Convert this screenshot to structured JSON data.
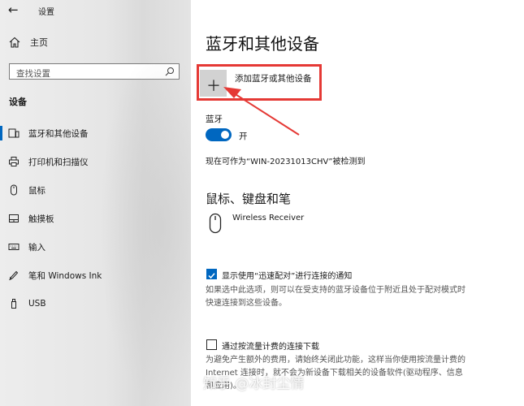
{
  "window": {
    "title": "设置",
    "back_icon": "back-arrow-icon"
  },
  "sidebar": {
    "home_label": "主页",
    "search_placeholder": "查找设置",
    "section_label": "设备",
    "selected_index": 0,
    "items": [
      {
        "label": "蓝牙和其他设备",
        "icon": "bluetooth-devices-icon"
      },
      {
        "label": "打印机和扫描仪",
        "icon": "printer-icon"
      },
      {
        "label": "鼠标",
        "icon": "mouse-icon"
      },
      {
        "label": "触摸板",
        "icon": "touchpad-icon"
      },
      {
        "label": "输入",
        "icon": "keyboard-icon"
      },
      {
        "label": "笔和 Windows Ink",
        "icon": "pen-icon"
      },
      {
        "label": "USB",
        "icon": "usb-icon"
      }
    ]
  },
  "main": {
    "title": "蓝牙和其他设备",
    "add_device_label": "添加蓝牙或其他设备",
    "bluetooth_label": "蓝牙",
    "bluetooth_state": "开",
    "bluetooth_on": true,
    "discoverable_text": "现在可作为“WIN-20231013CHV”被检测到",
    "mouse_section_title": "鼠标、键盘和笔",
    "devices": [
      {
        "name": "Wireless Receiver",
        "icon": "mouse-icon"
      }
    ],
    "swift_pair": {
      "checked": true,
      "label": "显示使用“迅速配对”进行连接的通知",
      "desc_line1": "如果选中此选项，则可以在受支持的蓝牙设备位于附近且处于配对模式时",
      "desc_line2": "快速连接到这些设备。"
    },
    "metered": {
      "checked": false,
      "label": "通过按流量计费的连接下载",
      "desc_line1": "为避免产生额外的费用，请始终关闭此功能，这样当你使用按流量计费的",
      "desc_line2": "Internet 连接时，就不会为新设备下载相关的设备软件(驱动程序、信息",
      "desc_line3": "和应用)。"
    }
  },
  "watermark": "知乎 @冰封尘情",
  "colors": {
    "accent": "#0067c0",
    "highlight_border": "#e53935"
  }
}
